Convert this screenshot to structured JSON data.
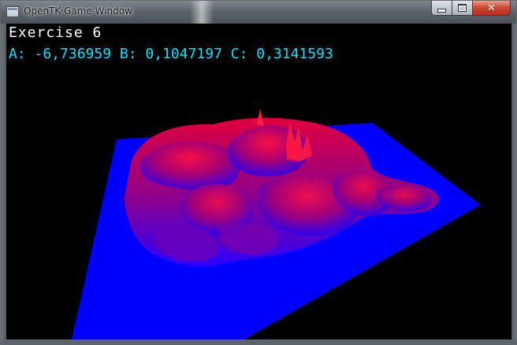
{
  "window": {
    "title": "OpenTK Game Window",
    "icons": {
      "app": "app-icon",
      "minimize": "minimize-icon",
      "maximize": "maximize-icon",
      "close": "close-icon"
    },
    "colors": {
      "close_button": "#c9462c"
    }
  },
  "hud": {
    "title": "Exercise 6",
    "params": "A: -6,736959 B: 0,1047197 C: 0,3141593",
    "colors": {
      "title": "#ffffff",
      "params": "#10e0ff"
    }
  },
  "scene": {
    "colors": {
      "background": "#000000",
      "plane": "#0000ff",
      "peak": "#e0003c"
    }
  }
}
